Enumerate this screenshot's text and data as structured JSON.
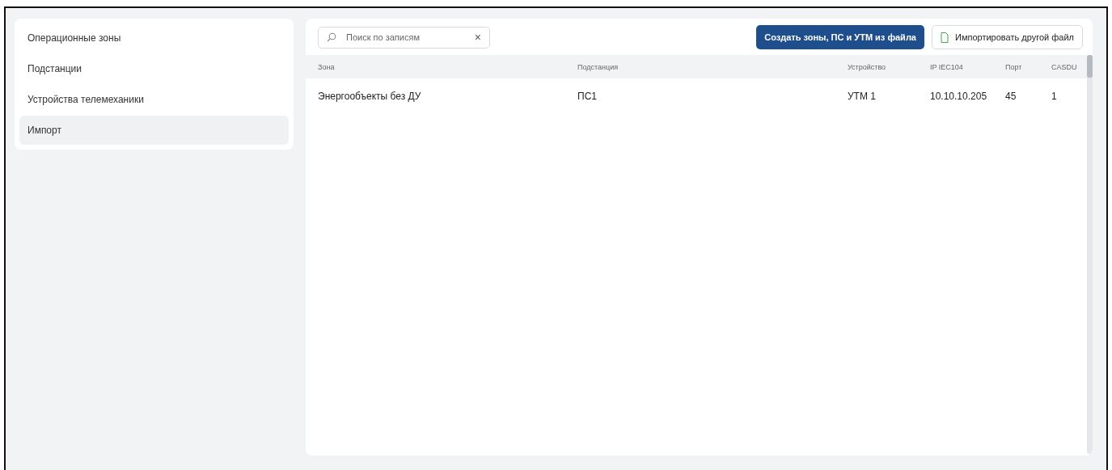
{
  "sidebar": {
    "items": [
      {
        "label": "Операционные зоны",
        "selected": false
      },
      {
        "label": "Подстанции",
        "selected": false
      },
      {
        "label": "Устройства телемеханики",
        "selected": false
      },
      {
        "label": "Импорт",
        "selected": true
      }
    ]
  },
  "search": {
    "placeholder": "Поиск по записям",
    "clear": "×"
  },
  "buttons": [
    {
      "kind": "primary",
      "label": "Создать зоны, ПС и УТМ из файла"
    },
    {
      "kind": "file",
      "label": "Импортировать другой файл"
    }
  ],
  "table": {
    "columns": [
      "Зона",
      "Подстанция",
      "Устройство",
      "IP IEC104",
      "Порт",
      "CASDU"
    ],
    "rows": [
      [
        "Энергообъекты без ДУ",
        "ПС1",
        "УТМ 1",
        "10.10.10.205",
        "45",
        "1"
      ]
    ]
  }
}
